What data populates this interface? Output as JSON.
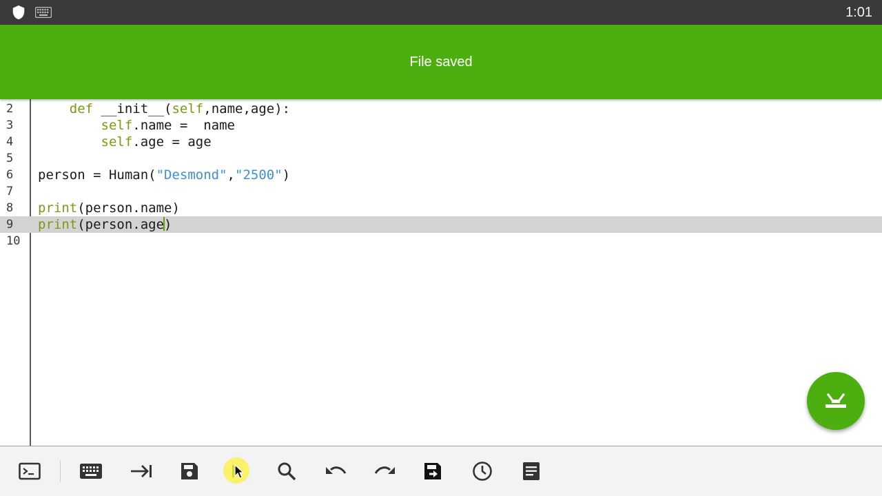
{
  "status_bar": {
    "time": "1:01",
    "icons": [
      "shield-icon",
      "keyboard-icon"
    ]
  },
  "toast": {
    "message": "File saved"
  },
  "editor": {
    "lines": [
      {
        "number": "2",
        "text": "    def __init__(self,name,age):"
      },
      {
        "number": "3",
        "text": "        self.name =  name"
      },
      {
        "number": "4",
        "text": "        self.age = age"
      },
      {
        "number": "5",
        "text": ""
      },
      {
        "number": "6",
        "text": "person = Human(\"Desmond\",\"2500\")"
      },
      {
        "number": "7",
        "text": ""
      },
      {
        "number": "8",
        "text": "print(person.name)"
      },
      {
        "number": "9",
        "text": "print(person.age)"
      },
      {
        "number": "10",
        "text": ""
      }
    ],
    "current_line": "9",
    "colors": {
      "keyword": "#7a9a16",
      "string": "#3d8fd6",
      "current_line_bg": "#d3d3d3"
    }
  },
  "fab": {
    "icon": "collapse-keyboard-icon"
  },
  "toolbar": {
    "buttons": [
      "terminal-icon",
      "keyboard-icon",
      "tab-icon",
      "save-icon",
      "run-icon",
      "search-icon",
      "undo-icon",
      "redo-icon",
      "save-as-icon",
      "history-icon",
      "menu-icon"
    ]
  },
  "theme": {
    "accent": "#4caf0f",
    "status_bar": "#3a3a3a",
    "toolbar_bg": "#f3f3f3"
  }
}
